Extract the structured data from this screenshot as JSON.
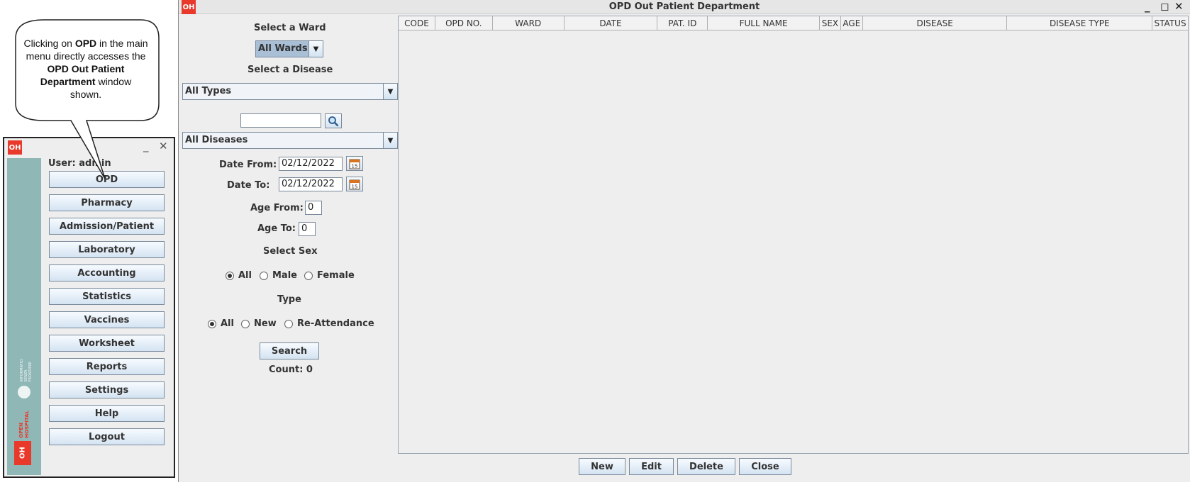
{
  "callout": {
    "t1": "Clicking on ",
    "t2": "OPD",
    "t3": " in the main menu directly accesses the ",
    "t4": "OPD Out Patient Department",
    "t5": " window shown."
  },
  "main_menu": {
    "logo": "OH",
    "user_label": "User: admin",
    "brand": "OPEN\nHOSPITAL",
    "foundation": "INFORMATICI\nSENZA\nFRONTIERE",
    "buttons": [
      "OPD",
      "Pharmacy",
      "Admission/Patient",
      "Laboratory",
      "Accounting",
      "Statistics",
      "Vaccines",
      "Worksheet",
      "Reports",
      "Settings",
      "Help",
      "Logout"
    ]
  },
  "opd": {
    "logo": "OH",
    "title": "OPD Out Patient Department",
    "select_ward_label": "Select a Ward",
    "ward_value": "All Wards",
    "select_disease_label": "Select a Disease",
    "disease_type_value": "All Types",
    "search_text": "",
    "disease_value": "All Diseases",
    "date_from_label": "Date From:",
    "date_from": "02/12/2022",
    "date_to_label": "Date To:",
    "date_to": "02/12/2022",
    "age_from_label": "Age From:",
    "age_from": "0",
    "age_to_label": "Age To:",
    "age_to": "0",
    "select_sex_label": "Select Sex",
    "sex_options": [
      "All",
      "Male",
      "Female"
    ],
    "type_label": "Type",
    "type_options": [
      "All",
      "New",
      "Re-Attendance"
    ],
    "search_button": "Search",
    "count": "Count: 0",
    "columns": [
      "CODE",
      "OPD NO.",
      "WARD",
      "DATE",
      "PAT. ID",
      "FULL NAME",
      "SEX",
      "AGE",
      "DISEASE",
      "DISEASE TYPE",
      "STATUS"
    ],
    "footer_buttons": [
      "New",
      "Edit",
      "Delete",
      "Close"
    ]
  },
  "colors": {
    "brand_red": "#e8392b",
    "sidebar_teal": "#8fb7b6",
    "window_bg": "#eeeeee"
  }
}
